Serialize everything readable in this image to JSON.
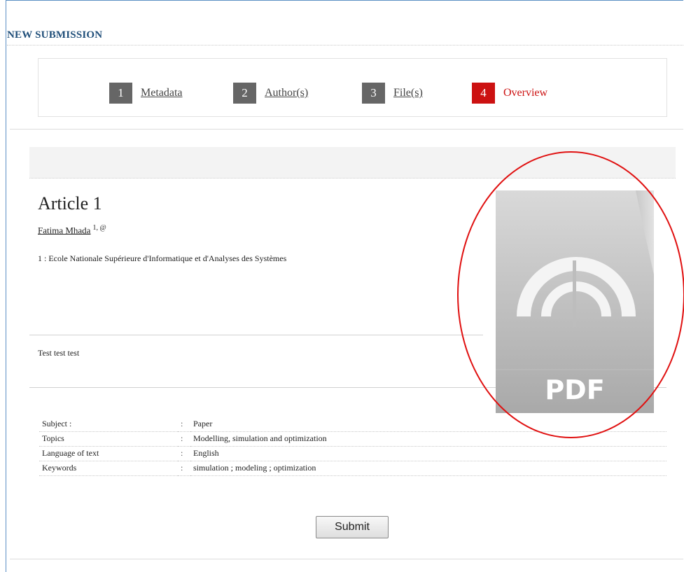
{
  "page": {
    "title": "NEW SUBMISSION"
  },
  "steps": [
    {
      "number": "1",
      "label": "Metadata"
    },
    {
      "number": "2",
      "label": "Author(s)"
    },
    {
      "number": "3",
      "label": "File(s)"
    },
    {
      "number": "4",
      "label": "Overview"
    }
  ],
  "article": {
    "title": "Article 1",
    "author_name": "Fatima Mhada",
    "author_sup": "1, @",
    "affiliation_num": "1 :",
    "affiliation": "Ecole Nationale Supérieure d'Informatique et d'Analyses des Systèmes",
    "abstract": "Test test test"
  },
  "metadata": [
    {
      "key": "Subject :",
      "sep": ":",
      "value": "Paper"
    },
    {
      "key": "Topics",
      "sep": ":",
      "value": "Modelling, simulation and optimization"
    },
    {
      "key": "Language of text",
      "sep": ":",
      "value": "English"
    },
    {
      "key": "Keywords",
      "sep": ":",
      "value": "simulation ; modeling ; optimization"
    }
  ],
  "pdf_preview": {
    "label": "PDF",
    "icon": "pdf-file-icon"
  },
  "buttons": {
    "submit": "Submit"
  },
  "colors": {
    "title_blue": "#1f4e79",
    "active_step": "#cc1111",
    "inactive_step": "#666666",
    "highlight_circle": "#e01010"
  }
}
